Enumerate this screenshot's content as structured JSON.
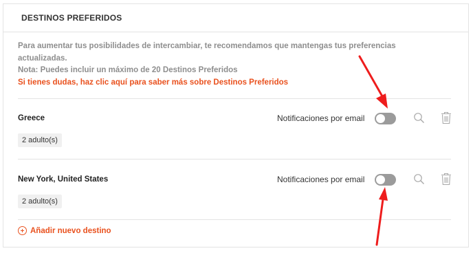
{
  "panel": {
    "title": "DESTINOS PREFERIDOS"
  },
  "info": {
    "line1": "Para aumentar tus posibilidades de intercambiar, te recomendamos que mantengas tus preferencias",
    "line2": "actualizadas.",
    "note": "Nota: Puedes incluir un máximo de 20 Destinos Preferidos",
    "link": "Si tienes dudas, haz clic aquí para saber más sobre Destinos Preferidos"
  },
  "destinations": [
    {
      "name": "Greece",
      "guests": "2 adulto(s)",
      "notif_label": "Notificaciones por email",
      "notif_enabled": false
    },
    {
      "name": "New York, United States",
      "guests": "2 adulto(s)",
      "notif_label": "Notificaciones por email",
      "notif_enabled": false
    }
  ],
  "add_destination_label": "Añadir nuevo destino",
  "icons": {
    "search": "search-icon",
    "delete": "trash-icon",
    "add": "plus-circle-icon"
  },
  "colors": {
    "accent": "#e9511e",
    "annotation_arrow": "#ee1d1d",
    "toggle_off": "#9b9b9b"
  }
}
